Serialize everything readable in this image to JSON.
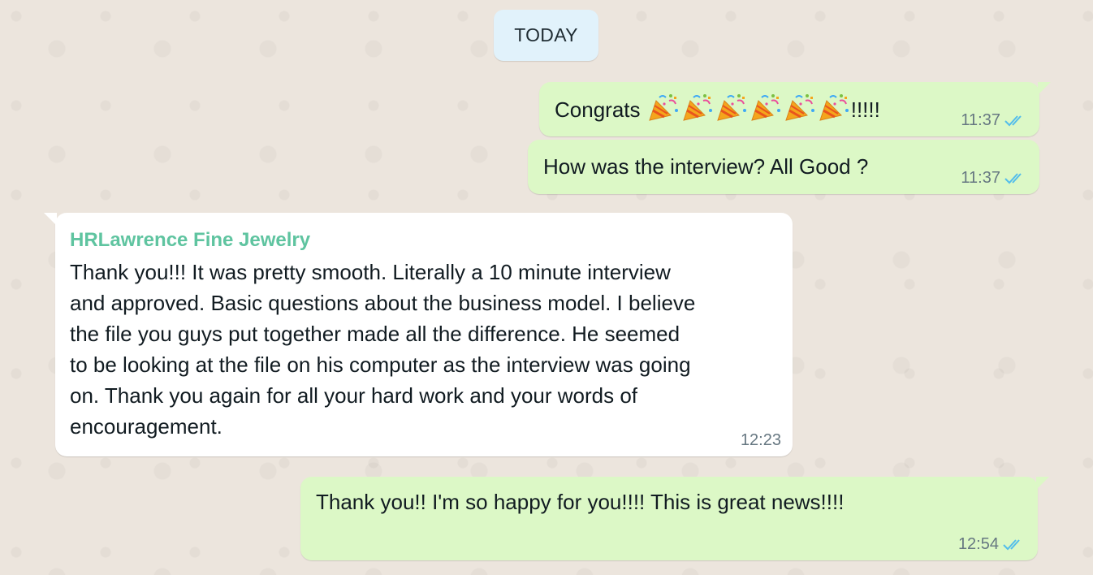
{
  "date_separator": "TODAY",
  "colors": {
    "outgoing_bubble": "#dcf8c6",
    "incoming_bubble": "#ffffff",
    "sender_name": "#5fc4a0",
    "read_ticks": "#53bdeb",
    "date_chip": "#e1f2fb",
    "background": "#ece5dd"
  },
  "messages": [
    {
      "direction": "outgoing",
      "text": "Congrats",
      "suffix": "!!!!!",
      "emoji": "party-popper",
      "emoji_count": 6,
      "time": "11:37",
      "status": "read"
    },
    {
      "direction": "outgoing",
      "text": "How was the interview? All Good ?",
      "time": "11:37",
      "status": "read"
    },
    {
      "direction": "incoming",
      "sender": "HRLawrence Fine Jewelry",
      "lines": [
        "Thank you!!! It was pretty smooth. Literally a 10 minute interview",
        "and approved. Basic questions about the business model. I believe",
        "the file you guys put together made all the difference. He seemed",
        "to be looking at the file on his computer as the interview was going",
        "on. Thank you again for all your hard work and your words of",
        "encouragement."
      ],
      "time": "12:23"
    },
    {
      "direction": "outgoing",
      "text": "Thank you!! I'm so happy for you!!!! This is great news!!!!",
      "time": "12:54",
      "status": "read"
    }
  ]
}
